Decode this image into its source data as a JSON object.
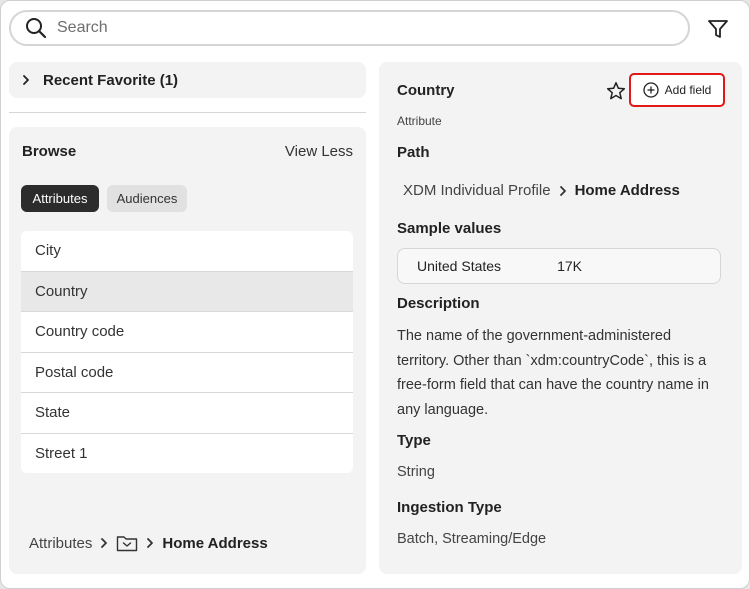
{
  "search": {
    "placeholder": "Search"
  },
  "recent": {
    "label": "Recent Favorite (1)"
  },
  "browse": {
    "title": "Browse",
    "toggle_label": "View Less",
    "tabs": [
      {
        "label": "Attributes",
        "active": true
      },
      {
        "label": "Audiences",
        "active": false
      }
    ],
    "items": [
      {
        "label": "City"
      },
      {
        "label": "Country",
        "selected": true
      },
      {
        "label": "Country code"
      },
      {
        "label": "Postal code"
      },
      {
        "label": "State"
      },
      {
        "label": "Street 1"
      }
    ],
    "breadcrumb": {
      "root": "Attributes",
      "folder_icon": "folder-icon",
      "current": "Home Address"
    }
  },
  "detail": {
    "title": "Country",
    "add_field_label": "Add field",
    "subtitle": "Attribute",
    "path_heading": "Path",
    "path": [
      "XDM Individual Profile",
      "Home Address"
    ],
    "sample_heading": "Sample values",
    "sample": {
      "value": "United States",
      "count": "17K"
    },
    "description_heading": "Description",
    "description": "The name of the government-administered territory. Other than `xdm:countryCode`, this is a free-form field that can have the country name in any language.",
    "type_heading": "Type",
    "type": "String",
    "ingestion_heading": "Ingestion Type",
    "ingestion": "Batch, Streaming/Edge"
  },
  "colors": {
    "accent_outline": "#e01818",
    "active_tab": "#2c2c2c",
    "panel_bg": "#f3f3f3"
  }
}
